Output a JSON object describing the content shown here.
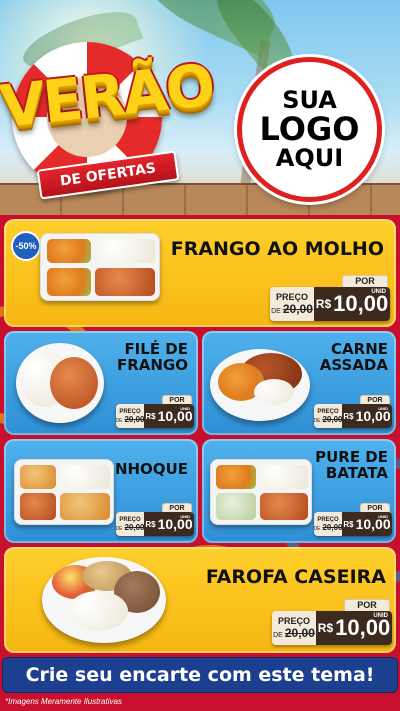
{
  "header": {
    "title": "VERÃO",
    "subtitle": "DE OFERTAS",
    "logo_lines": [
      "SUA",
      "LOGO",
      "AQUI"
    ]
  },
  "price_labels": {
    "preco": "PREÇO",
    "de": "DE",
    "por": "POR",
    "currency": "R$",
    "unid": "UNID"
  },
  "products": [
    {
      "name_lines": [
        "FRANGO AO MOLHO"
      ],
      "badge": "-50%",
      "old_price": "20,00",
      "price": "10,00",
      "image": "tray-chicken-icon"
    },
    {
      "name_lines": [
        "FILÉ DE",
        "FRANGO"
      ],
      "old_price": "20,00",
      "price": "10,00",
      "image": "bowl-chicken-icon"
    },
    {
      "name_lines": [
        "CARNE",
        "ASSADA"
      ],
      "old_price": "20,00",
      "price": "10,00",
      "image": "bowl-beef-icon"
    },
    {
      "name_lines": [
        "NHOQUE"
      ],
      "old_price": "20,00",
      "price": "10,00",
      "image": "tray-gnocchi-icon"
    },
    {
      "name_lines": [
        "PURE DE",
        "BATATA"
      ],
      "old_price": "20,00",
      "price": "10,00",
      "image": "tray-mashed-potato-icon"
    },
    {
      "name_lines": [
        "FAROFA CASEIRA"
      ],
      "old_price": "20,00",
      "price": "10,00",
      "image": "bowl-farofa-icon"
    }
  ],
  "cta": "Crie seu encarte com este tema!",
  "disclaimer": "*Imagens Meramente Ilustrativas",
  "colors": {
    "background": "#c8102e",
    "yellow_card": "#f6b612",
    "blue_card": "#2f8fd6",
    "cta": "#1d3f8f",
    "price_dark": "#3b2a1d"
  }
}
